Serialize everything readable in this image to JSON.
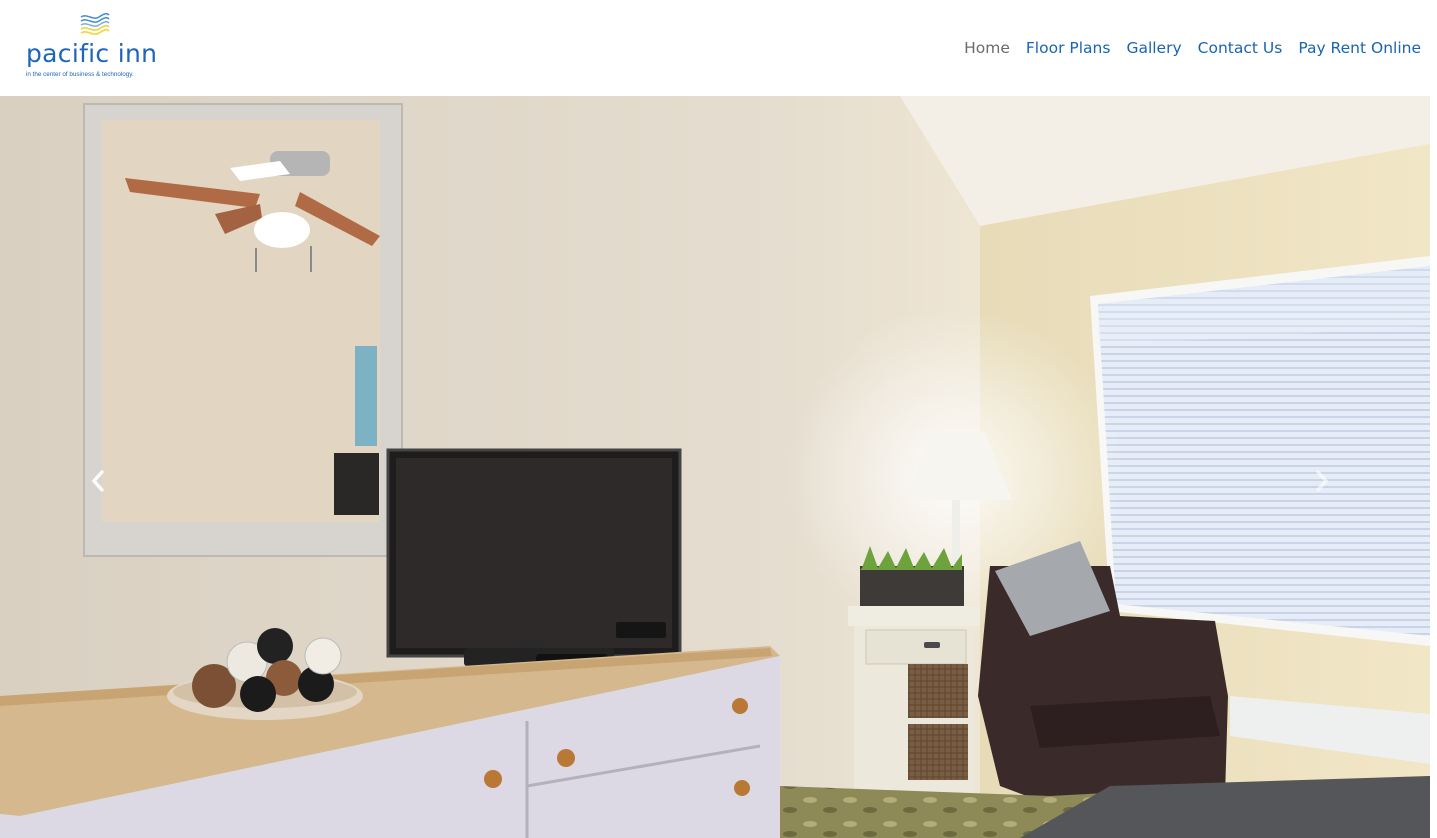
{
  "site": {
    "logo": {
      "name": "pacific inn",
      "tagline": "in the center of business & technology.",
      "colors": {
        "text": "#1f65b8",
        "wave_blue": "#4a8fd6",
        "wave_yellow": "#f2d64b"
      }
    }
  },
  "nav": {
    "items": [
      {
        "label": "Home",
        "active": true
      },
      {
        "label": "Floor Plans",
        "active": false
      },
      {
        "label": "Gallery",
        "active": false
      },
      {
        "label": "Contact Us",
        "active": false
      },
      {
        "label": "Pay Rent Online",
        "active": false
      }
    ],
    "link_color": "#1a64b4",
    "active_color": "#6b6b6b"
  },
  "carousel": {
    "slide": {
      "image": "bedroom-interior-photo",
      "contents": [
        "wall-mirror",
        "ceiling-fan-reflection",
        "flat-screen-tv",
        "dresser",
        "decorative-bowl",
        "floor-lamp",
        "potted-grass",
        "nightstand",
        "leather-armchair",
        "window-blinds"
      ]
    },
    "controls": {
      "prev_icon": "chevron-left-icon",
      "next_icon": "chevron-right-icon"
    }
  }
}
